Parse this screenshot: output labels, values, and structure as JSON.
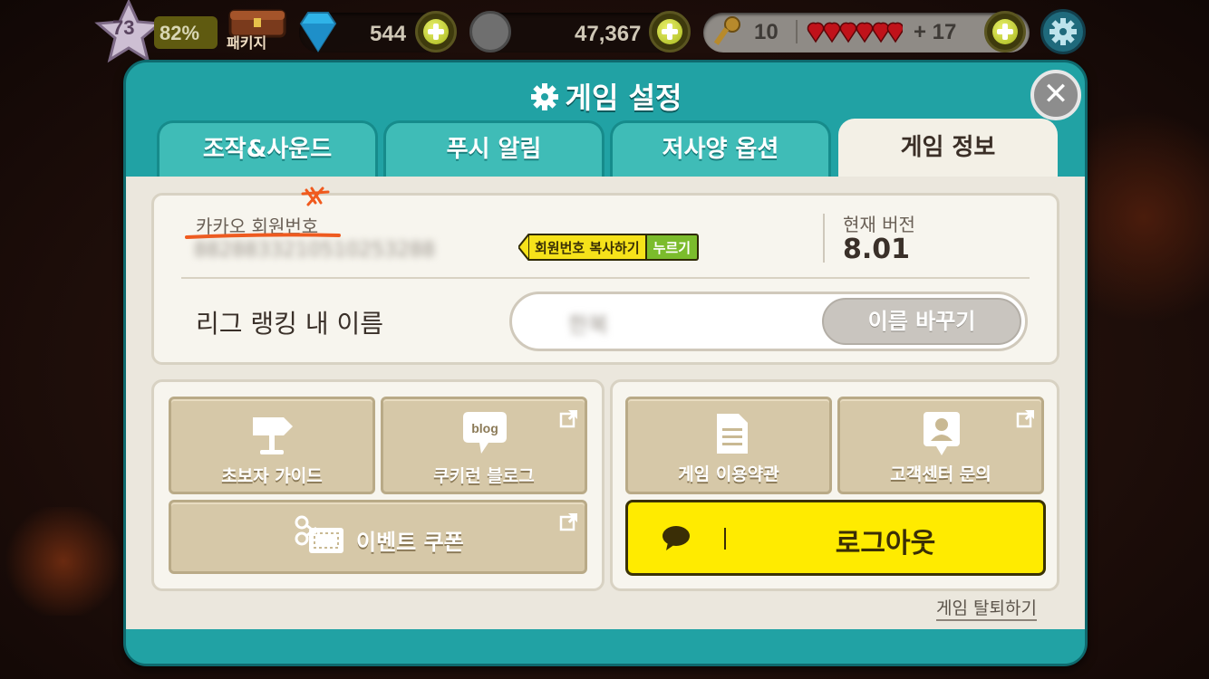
{
  "hud": {
    "level": "73",
    "exp_percent": "82%",
    "package_label": "패키지",
    "gems": "544",
    "coins": "47,367",
    "keys": "10",
    "hearts_extra": "+ 17"
  },
  "dialog": {
    "title": "게임 설정",
    "tabs": [
      {
        "label": "조작&사운드"
      },
      {
        "label": "푸시 알림"
      },
      {
        "label": "저사양 옵션"
      },
      {
        "label": "게임 정보"
      }
    ],
    "active_tab": "게임 정보"
  },
  "info": {
    "member_label": "카카오 회원번호",
    "member_id": "8828833210510253288",
    "copy_label": "회원번호 복사하기",
    "copy_press": "누르기",
    "version_label": "현재 버전",
    "version": "8.01",
    "ranking_label": "리그 랭킹 내 이름",
    "ranking_name": "한복",
    "rename_button": "이름 바꾸기"
  },
  "tiles": {
    "guide": "초보자 가이드",
    "blog": "쿠키런 블로그",
    "blog_icon_text": "blog",
    "coupon": "이벤트 쿠폰",
    "terms": "게임 이용약관",
    "support": "고객센터 문의",
    "logout": "로그아웃"
  },
  "withdraw": "게임 탈퇴하기",
  "colors": {
    "teal": "#21a2a4",
    "tile": "#d6c8a8",
    "logout_yellow": "#ffeb00"
  }
}
